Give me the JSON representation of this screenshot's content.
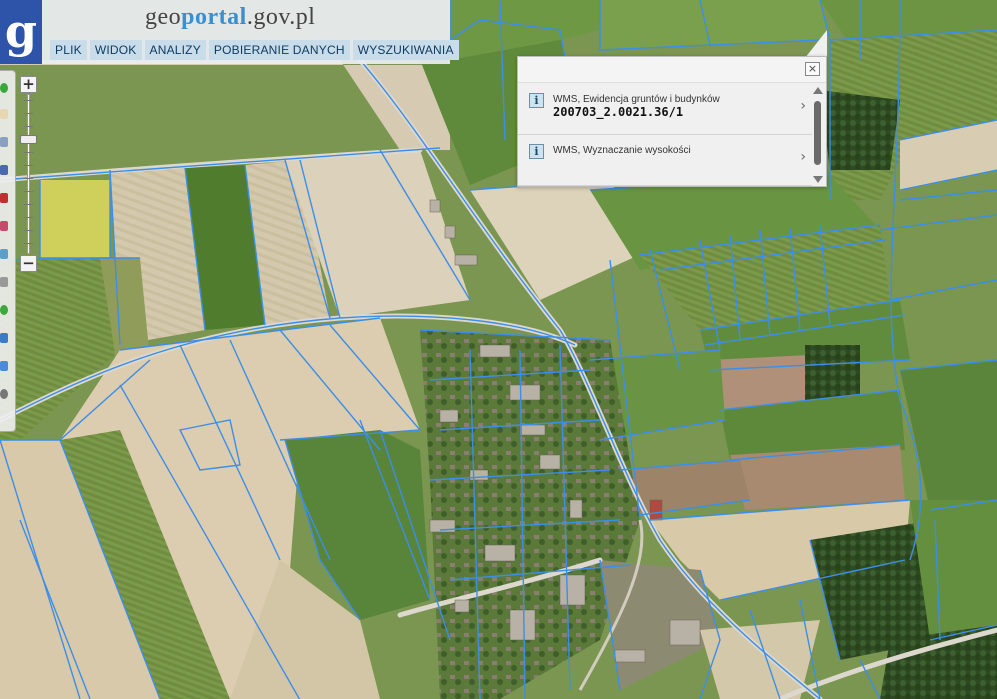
{
  "header": {
    "logo_letter": "g",
    "site_title_lead": "g",
    "site_title_rest_1": "eo",
    "site_title_hl": "portal",
    "site_title_tail": ".gov.pl",
    "menu": [
      "PLIK",
      "WIDOK",
      "ANALIZY",
      "POBIERANIE DANYCH",
      "WYSZUKIWANIA"
    ]
  },
  "zoom": {
    "in_label": "+",
    "out_label": "−",
    "level_fraction": 0.28
  },
  "popup": {
    "close_label": "×",
    "items": [
      {
        "label": "WMS, Ewidencja gruntów i budynków",
        "value": "200703_2.0021.36/1",
        "icon": "info-icon",
        "arrow": "›"
      },
      {
        "label": "WMS, Wyznaczanie wysokości",
        "value": "",
        "icon": "info-icon",
        "arrow": "›"
      }
    ]
  },
  "map_colors": {
    "parcel_line": "#3d8ee6",
    "field_light": "#cfc2a6",
    "field_green": "#6e8a3f",
    "field_dark": "#4a6a2e",
    "field_yellow": "#cfcf5a",
    "forest": "#2f4a24",
    "road": "#d9d4cb"
  }
}
